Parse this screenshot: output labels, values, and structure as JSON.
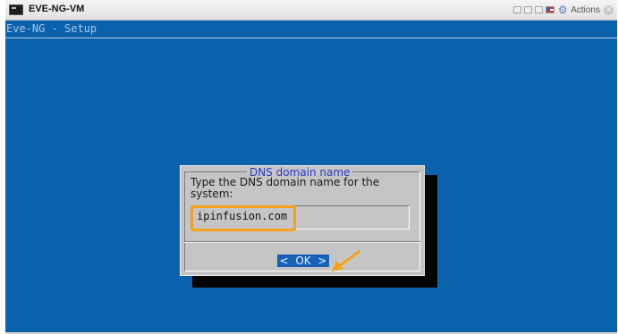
{
  "window": {
    "title": "EVE-NG-VM",
    "actions_label": "Actions"
  },
  "console": {
    "header_title": "Eve-NG - Setup"
  },
  "dialog": {
    "title": "DNS domain name",
    "prompt": "Type the DNS domain name for the\nsystem:",
    "input_value": "ipinfusion.com",
    "ok_label": "<  OK  >"
  },
  "icons": {
    "vm": "vm-console-icon",
    "gear": "gear-icon",
    "flag": "flag-icon",
    "close": "close-icon"
  },
  "colors": {
    "console_background": "#0a62ad",
    "dialog_background": "#c5c5c5",
    "dialog_title": "#2a3cc8",
    "ok_button": "#1762b7",
    "annotation_highlight": "#f5a21a"
  }
}
